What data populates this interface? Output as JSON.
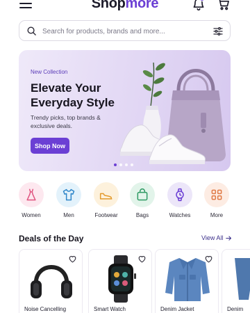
{
  "header": {
    "brand_part1": "Shop",
    "brand_part2": "more",
    "menu_icon": "hamburger-menu-icon",
    "notification_icon": "bell-icon",
    "cart_icon": "cart-icon"
  },
  "search": {
    "placeholder": "Search for products, brands and more...",
    "value": "",
    "search_icon": "search-icon",
    "filter_icon": "filter-sliders-icon"
  },
  "banner": {
    "tag": "New Collection",
    "title": "Elevate Your Everyday Style",
    "subtitle": "Trendy picks, top brands & exclusive deals.",
    "cta_label": "Shop Now",
    "slides": 4,
    "active_slide": 1
  },
  "categories": [
    {
      "label": "Women",
      "icon": "dress-icon",
      "bg": "#fde8ef",
      "fg": "#e0537f"
    },
    {
      "label": "Men",
      "icon": "tshirt-icon",
      "bg": "#e3f2fb",
      "fg": "#2f86c9"
    },
    {
      "label": "Footwear",
      "icon": "shoe-icon",
      "bg": "#fdf1dc",
      "fg": "#e39a2c"
    },
    {
      "label": "Bags",
      "icon": "bag-icon",
      "bg": "#e2f4ea",
      "fg": "#2e9a63"
    },
    {
      "label": "Watches",
      "icon": "watch-icon",
      "bg": "#ece6f9",
      "fg": "#6b3fd4"
    },
    {
      "label": "More",
      "icon": "grid-icon",
      "bg": "#fdece3",
      "fg": "#e07a45"
    }
  ],
  "deals": {
    "title": "Deals of the Day",
    "view_all": "View All",
    "items": [
      {
        "name": "Noise Cancelling",
        "icon": "headphones-icon"
      },
      {
        "name": "Smart Watch",
        "icon": "smartwatch-icon"
      },
      {
        "name": "Denim Jacket",
        "icon": "jacket-icon"
      },
      {
        "name": "Denim",
        "icon": "jeans-icon"
      }
    ]
  },
  "colors": {
    "accent": "#6b3fd4",
    "text": "#1c1b2a",
    "banner_bg": "#e4daf5"
  }
}
